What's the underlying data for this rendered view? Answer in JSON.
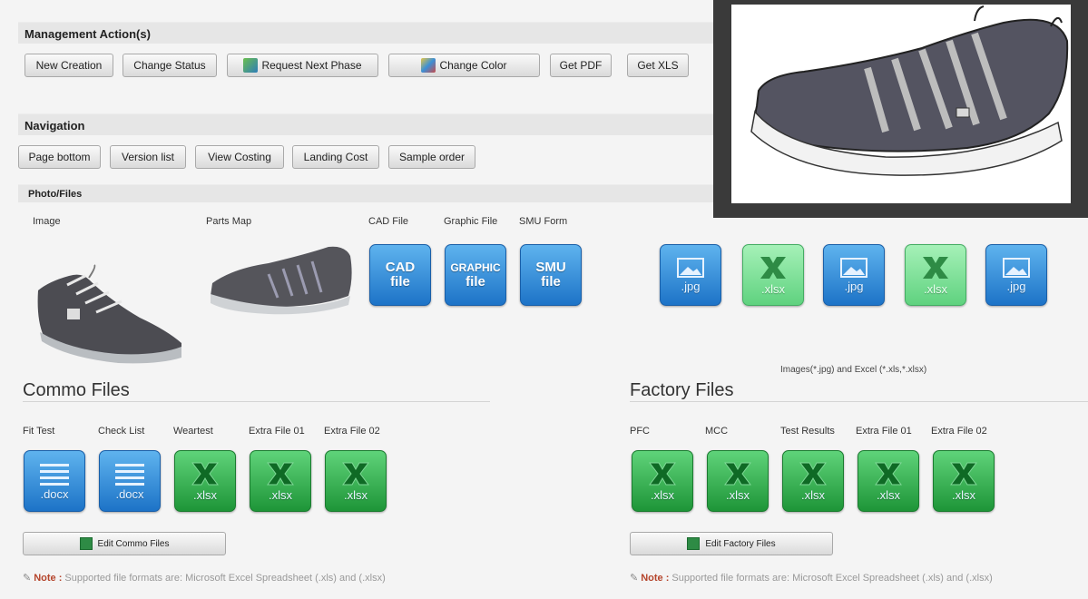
{
  "management": {
    "title": "Management Action(s)",
    "buttons": [
      "New Creation",
      "Change Status",
      "Request Next Phase",
      "Change Color",
      "Get PDF",
      "Get XLS"
    ]
  },
  "navigation": {
    "title": "Navigation",
    "buttons": [
      "Page bottom",
      "Version list",
      "View Costing",
      "Landing Cost",
      "Sample order"
    ]
  },
  "photo_files": {
    "title": "Photo/Files",
    "labels": [
      "Image",
      "Parts Map",
      "CAD File",
      "Graphic File",
      "SMU Form"
    ],
    "tiles": [
      {
        "word": "CAD",
        "sub": "file"
      },
      {
        "word": "GRAPHIC",
        "sub": "file"
      },
      {
        "word": "SMU",
        "sub": "file"
      }
    ],
    "extra_tiles": [
      ".jpg",
      ".xlsx",
      ".jpg",
      ".xlsx",
      ".jpg"
    ],
    "caption": "Images(*.jpg) and Excel (*.xls,*.xlsx)"
  },
  "commo": {
    "title": "Commo Files",
    "labels": [
      "Fit Test",
      "Check List",
      "Weartest",
      "Extra File 01",
      "Extra File 02"
    ],
    "exts": [
      ".docx",
      ".docx",
      ".xlsx",
      ".xlsx",
      ".xlsx"
    ],
    "edit_button": "Edit Commo Files",
    "note_label": "Note :",
    "note_text": "Supported file formats are: Microsoft Excel Spreadsheet (.xls) and (.xlsx)"
  },
  "factory": {
    "title": "Factory Files",
    "labels": [
      "PFC",
      "MCC",
      "Test Results",
      "Extra File 01",
      "Extra File 02"
    ],
    "exts": [
      ".xlsx",
      ".xlsx",
      ".xlsx",
      ".xlsx",
      ".xlsx"
    ],
    "edit_button": "Edit Factory Files",
    "note_label": "Note :",
    "note_text": "Supported file formats are: Microsoft Excel Spreadsheet (.xls) and (.xlsx)"
  },
  "colors": {
    "tile_blue": "#1d73c7",
    "tile_green": "#1e9538",
    "note_red": "#b5452c"
  }
}
